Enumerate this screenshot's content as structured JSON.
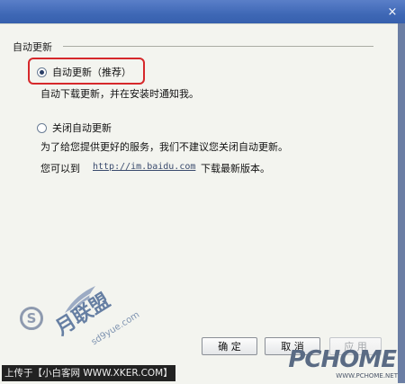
{
  "window": {
    "close_symbol": "×"
  },
  "group": {
    "title": "自动更新"
  },
  "options": {
    "auto": {
      "label": "自动更新（推荐）",
      "desc": "自动下载更新，并在安装时通知我。",
      "checked": true
    },
    "off": {
      "label": "关闭自动更新",
      "desc": "为了给您提供更好的服务，我们不建议您关闭自动更新。",
      "checked": false
    }
  },
  "download": {
    "prefix": "您可以到",
    "url": "http://im.baidu.com",
    "suffix": "下载最新版本。"
  },
  "buttons": {
    "ok": "确 定",
    "cancel": "取 消",
    "apply": "应 用"
  },
  "watermark": {
    "site_text": "月联盟",
    "ring_letter": "S",
    "sub": "sd9yue.com",
    "caption": "上传于【小白客网 WWW.XKER.COM】"
  },
  "brand": {
    "logo": "PCHOME",
    "url": "WWW.PCHOME.NET"
  }
}
